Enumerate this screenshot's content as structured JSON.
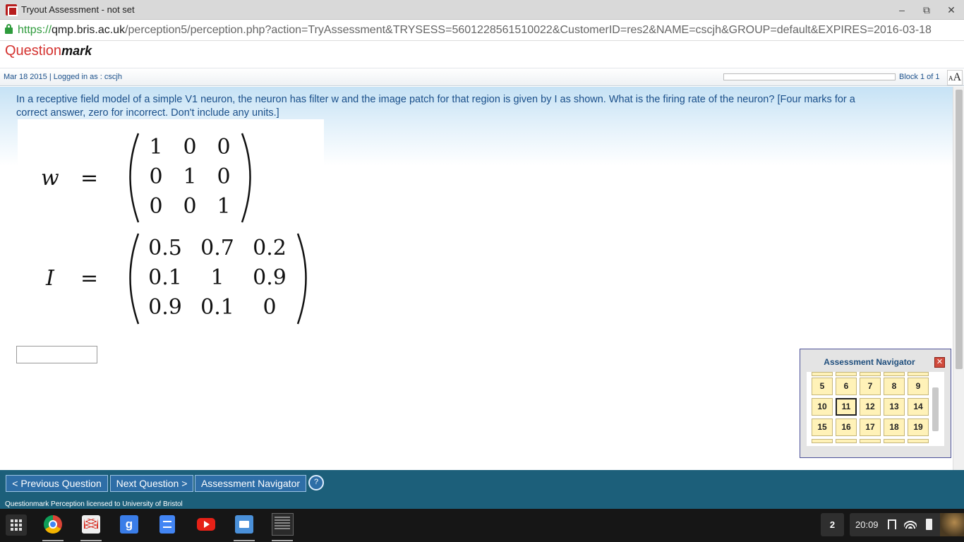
{
  "window": {
    "title": "Tryout Assessment - not set",
    "minimize_icon": "minimize-icon",
    "restore_icon": "restore-icon",
    "close_icon": "close-icon"
  },
  "address_bar": {
    "scheme": "https://",
    "host": "qmp.bris.ac.uk",
    "path": "/perception5/perception.php?action=TryAssessment&TRYSESS=5601228561510022&CustomerID=res2&NAME=cscjh&GROUP=default&EXPIRES=2016-03-18"
  },
  "logo": {
    "part1": "Question",
    "part2": "mark"
  },
  "info_bar": {
    "session": "Mar 18 2015 | Logged in as : cscjh",
    "block": "Block 1 of 1",
    "font_icon_small": "A",
    "font_icon_big": "A"
  },
  "question": {
    "text": "In a receptive field model of a simple V1 neuron, the neuron has filter w and the image patch for that region is given by I as shown. What is the firing rate of the neuron? [Four marks for a correct answer, zero for incorrect. Don't include any units.]",
    "answer_value": ""
  },
  "matrices": [
    {
      "name": "w",
      "equals": "=",
      "rows": [
        [
          "1",
          "0",
          "0"
        ],
        [
          "0",
          "1",
          "0"
        ],
        [
          "0",
          "0",
          "1"
        ]
      ]
    },
    {
      "name": "I",
      "equals": "=",
      "rows": [
        [
          "0.5",
          "0.7",
          "0.2"
        ],
        [
          "0.1",
          "1",
          "0.9"
        ],
        [
          "0.9",
          "0.1",
          "0"
        ]
      ]
    }
  ],
  "navigator": {
    "title": "Assessment Navigator",
    "close_label": "✕",
    "current": "11",
    "rows": [
      [
        "5",
        "6",
        "7",
        "8",
        "9"
      ],
      [
        "10",
        "11",
        "12",
        "13",
        "14"
      ],
      [
        "15",
        "16",
        "17",
        "18",
        "19"
      ]
    ]
  },
  "toolbar": {
    "previous_label": "< Previous Question",
    "next_label": "Next Question >",
    "navigator_label": "Assessment Navigator",
    "help_label": "?",
    "license": "Questionmark Perception licensed to University of Bristol"
  },
  "taskbar": {
    "google_label": "g",
    "badge": "2",
    "clock": "20:09"
  }
}
